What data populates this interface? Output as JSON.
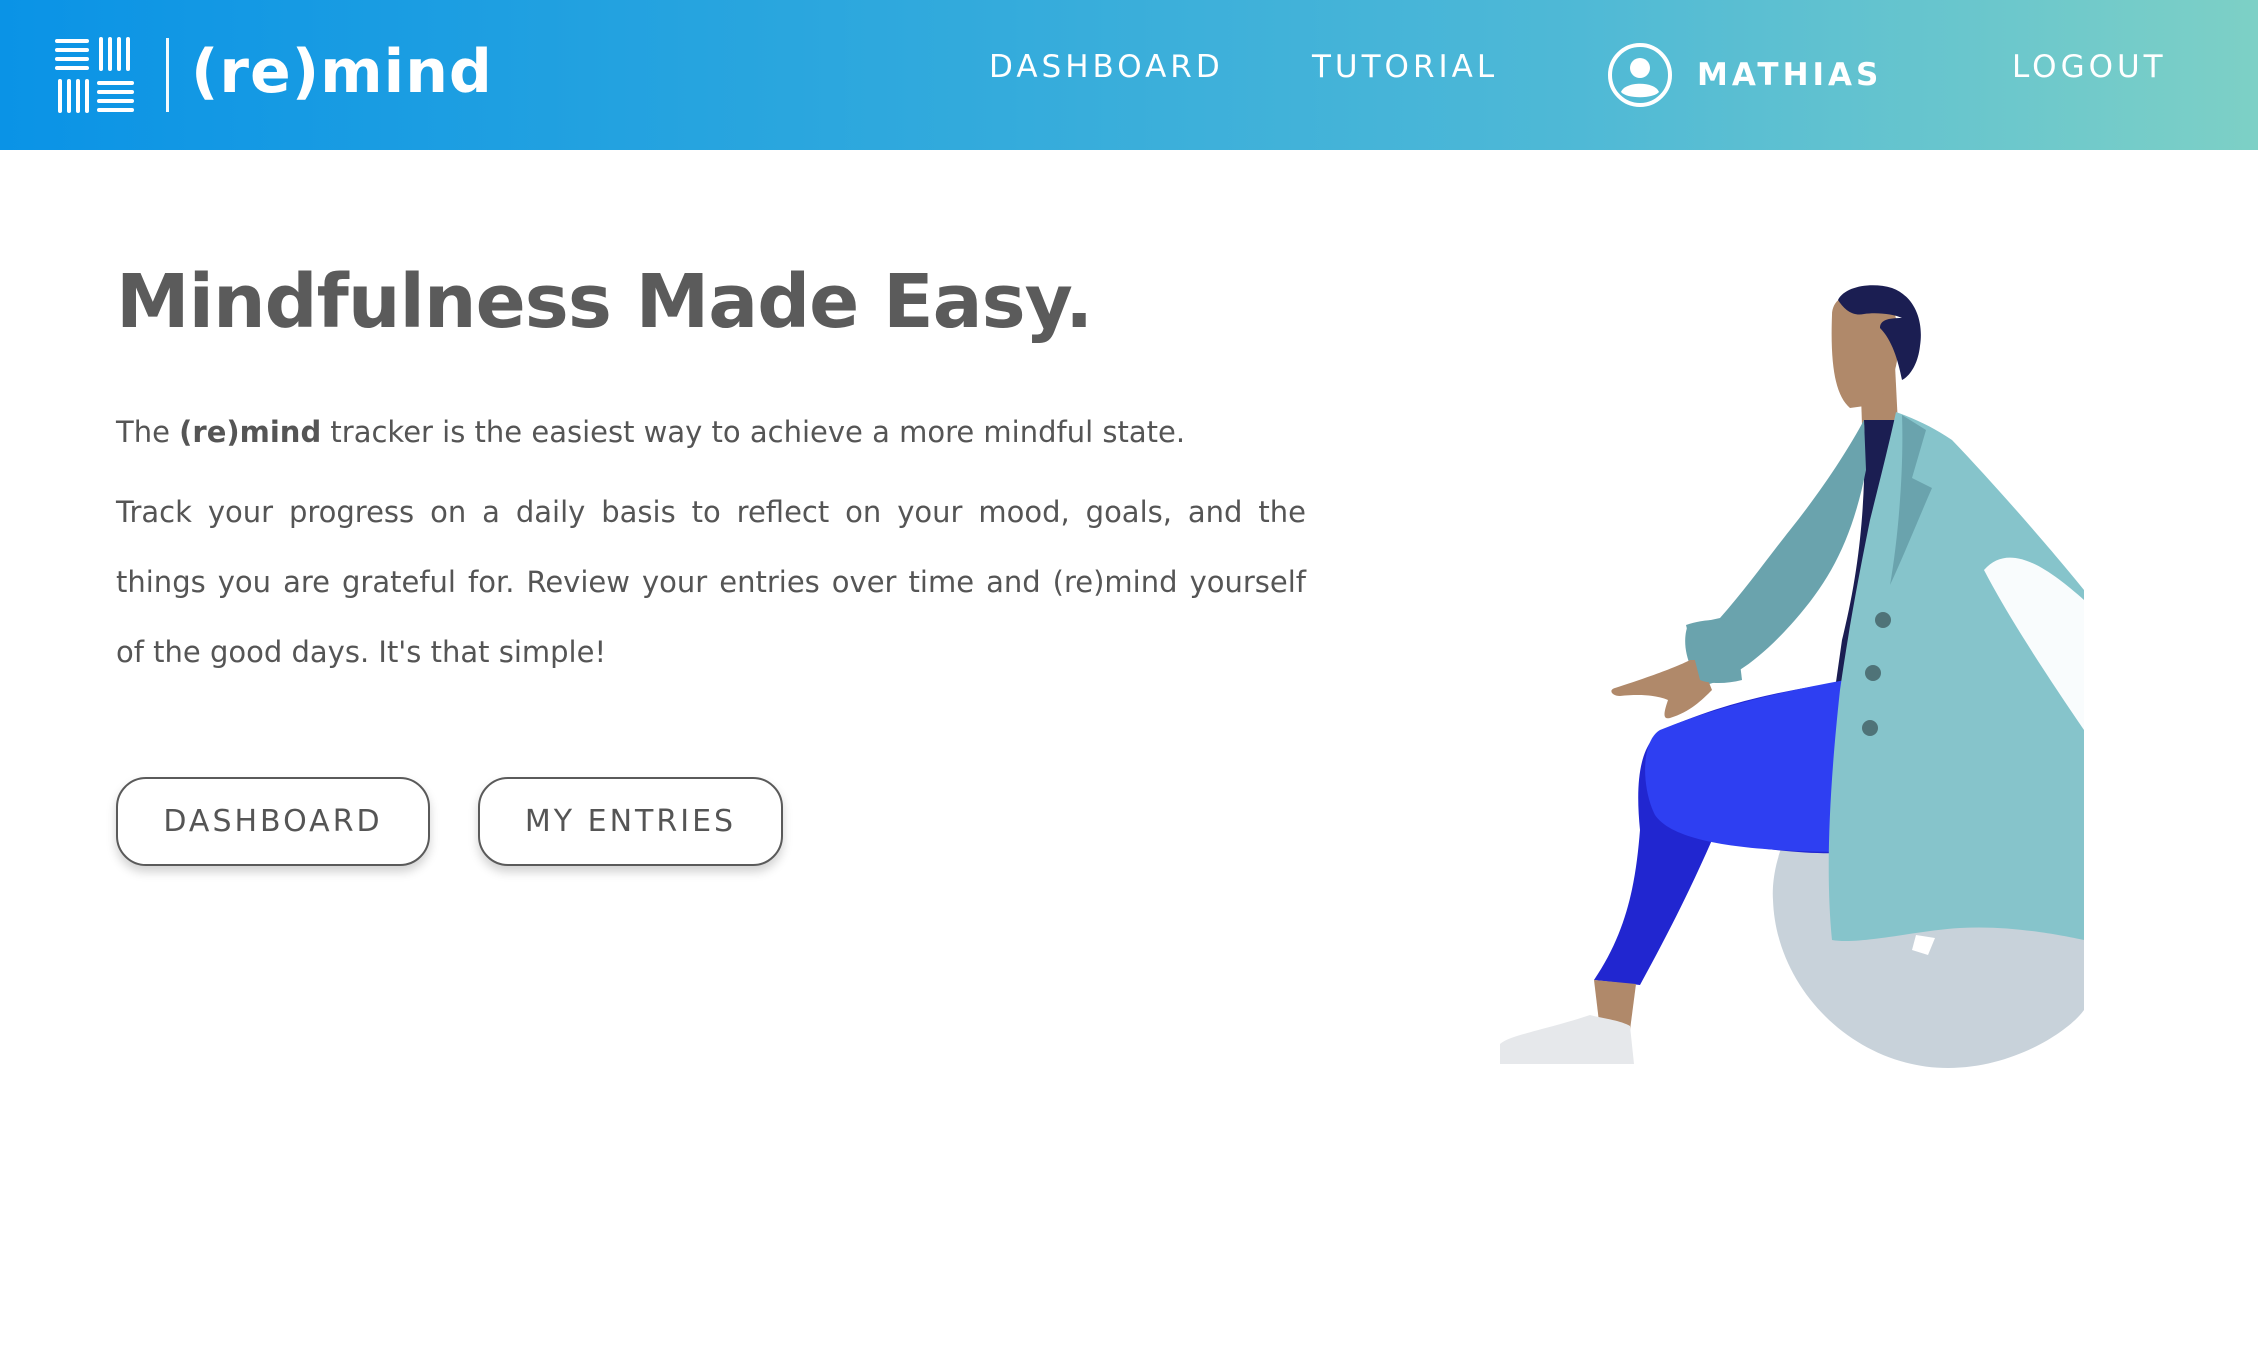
{
  "header": {
    "brand": "(re)mind",
    "nav": {
      "dashboard": "DASHBOARD",
      "tutorial": "TUTORIAL",
      "user_name": "MATHIAS",
      "logout": "LOGOUT"
    }
  },
  "hero": {
    "title": "Mindfulness Made Easy.",
    "intro_prefix": "The ",
    "intro_brand": "(re)mind",
    "intro_suffix": " tracker is the easiest way to achieve a more mindful state.",
    "body": "Track your progress on a daily basis to reflect on your mood, goals, and the things you are grateful for. Review your entries over time and (re)mind yourself of the good days. It's that simple!"
  },
  "buttons": {
    "dashboard": "DASHBOARD",
    "entries": "MY ENTRIES"
  },
  "colors": {
    "header_gradient_start": "#0a93e6",
    "header_gradient_end": "#7dd0c6",
    "text": "#5b5b5b"
  },
  "icons": {
    "logo": "remind-logo-icon",
    "avatar": "user-avatar-icon"
  }
}
